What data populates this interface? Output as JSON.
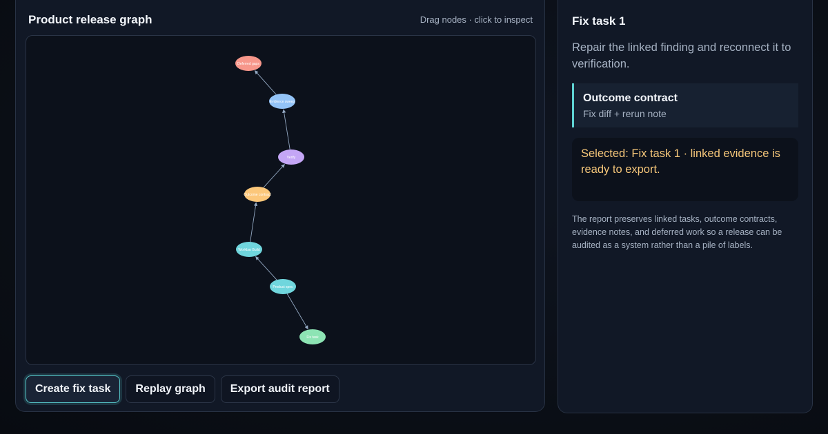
{
  "graph_panel": {
    "title": "Product release graph",
    "hint": "Drag nodes · click to inspect"
  },
  "graph": {
    "nodes": [
      {
        "id": "deferred",
        "label": "Deferred gaps",
        "color": "#f7978b"
      },
      {
        "id": "evidence",
        "label": "Evidence sweep",
        "color": "#93c3f7"
      },
      {
        "id": "verify",
        "label": "Verify",
        "color": "#c4a6f6"
      },
      {
        "id": "outcome",
        "label": "Outcome contract",
        "color": "#fcc77a"
      },
      {
        "id": "workbar",
        "label": "Workbar Build",
        "color": "#70d6dd"
      },
      {
        "id": "product",
        "label": "Product spec",
        "color": "#70d6dd"
      },
      {
        "id": "fix",
        "label": "Fix task",
        "color": "#8de4b4"
      }
    ],
    "edges": [
      {
        "from": "evidence",
        "to": "deferred"
      },
      {
        "from": "verify",
        "to": "evidence"
      },
      {
        "from": "outcome",
        "to": "verify"
      },
      {
        "from": "workbar",
        "to": "outcome"
      },
      {
        "from": "product",
        "to": "workbar"
      },
      {
        "from": "product",
        "to": "fix"
      }
    ],
    "edge_color": "#93a8c2"
  },
  "actions": {
    "create_fix": "Create fix task",
    "replay": "Replay graph",
    "export": "Export audit report"
  },
  "detail": {
    "title": "Fix task 1",
    "description": "Repair the linked finding and reconnect it to verification.",
    "contract_title": "Outcome contract",
    "contract_value": "Fix diff + rerun note",
    "status": "Selected: Fix task 1 · linked evidence is ready to export.",
    "note": "The report preserves linked tasks, outcome contracts, evidence notes, and deferred work so a release can be audited as a system rather than a pile of labels."
  },
  "colors": {
    "accent": "#56c6c9",
    "status_text": "#f6c77a",
    "panel_bg": "#111826"
  }
}
